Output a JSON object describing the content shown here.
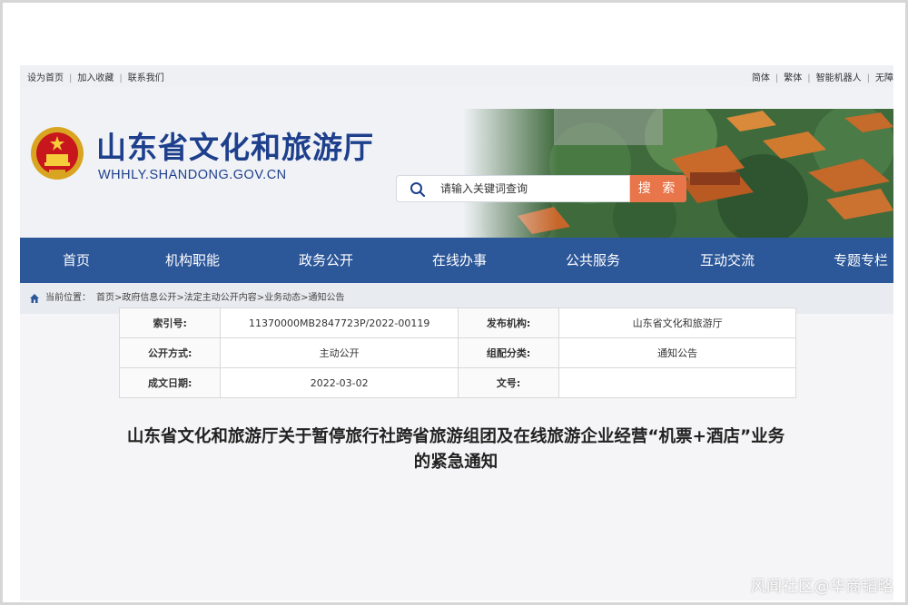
{
  "utility_bar": {
    "left_links": [
      "设为首页",
      "加入收藏",
      "联系我们"
    ],
    "right_links": [
      "简体",
      "繁体",
      "智能机器人",
      "无障"
    ]
  },
  "header": {
    "site_title": "山东省文化和旅游厅",
    "site_domain": "WHHLY.SHANDONG.GOV.CN",
    "search_placeholder": "请输入关键词查询",
    "search_button": "搜 索"
  },
  "nav": {
    "items": [
      "首页",
      "机构职能",
      "政务公开",
      "在线办事",
      "公共服务",
      "互动交流",
      "专题专栏"
    ]
  },
  "breadcrumb": {
    "label": "当前位置：",
    "path": "首页>政府信息公开>法定主动公开内容>业务动态>通知公告"
  },
  "info_table": {
    "rows": [
      {
        "k1": "索引号:",
        "v1": "11370000MB2847723P/2022-00119",
        "k2": "发布机构:",
        "v2": "山东省文化和旅游厅"
      },
      {
        "k1": "公开方式:",
        "v1": "主动公开",
        "k2": "组配分类:",
        "v2": "通知公告"
      },
      {
        "k1": "成文日期:",
        "v1": "2022-03-02",
        "k2": "文号:",
        "v2": ""
      }
    ]
  },
  "article": {
    "title": "山东省文化和旅游厅关于暂停旅行社跨省旅游组团及在线旅游企业经营“机票+酒店”业务的紧急通知"
  },
  "watermark": "风闻社区@华商韬略",
  "colors": {
    "brand_blue": "#1d3f8c",
    "nav_blue": "#2c5799",
    "search_orange": "#e9754a"
  }
}
